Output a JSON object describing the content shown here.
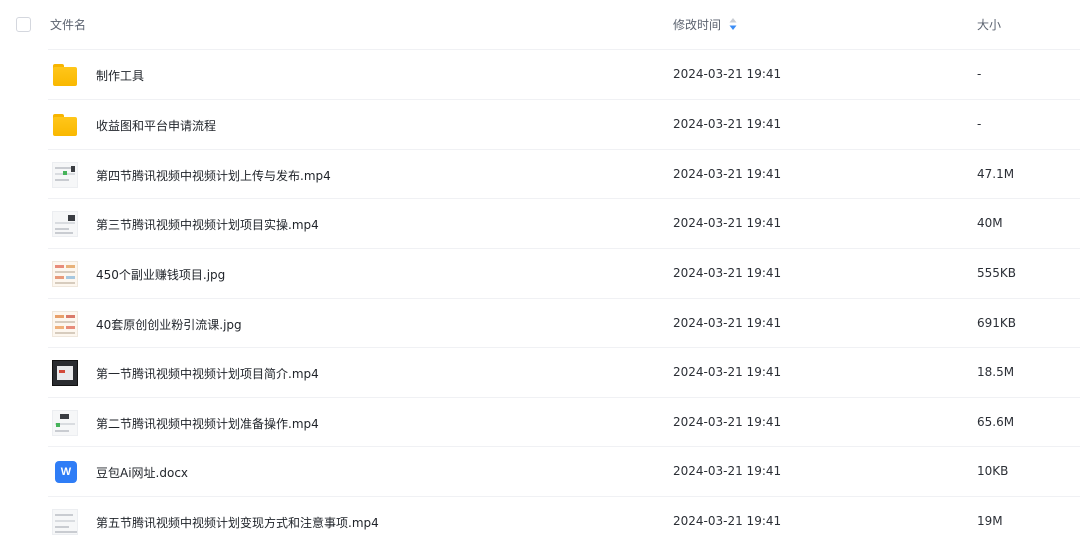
{
  "header": {
    "name_label": "文件名",
    "time_label": "修改时间",
    "size_label": "大小",
    "sort_icon": "sort-arrows-icon"
  },
  "files": [
    {
      "name": "制作工具",
      "time": "2024-03-21 19:41",
      "size": "-",
      "type": "folder"
    },
    {
      "name": "收益图和平台申请流程",
      "time": "2024-03-21 19:41",
      "size": "-",
      "type": "folder"
    },
    {
      "name": "第四节腾讯视频中视频计划上传与发布.mp4",
      "time": "2024-03-21 19:41",
      "size": "47.1M",
      "type": "video"
    },
    {
      "name": "第三节腾讯视频中视频计划项目实操.mp4",
      "time": "2024-03-21 19:41",
      "size": "40M",
      "type": "video"
    },
    {
      "name": "450个副业赚钱项目.jpg",
      "time": "2024-03-21 19:41",
      "size": "555KB",
      "type": "image"
    },
    {
      "name": "40套原创创业粉引流课.jpg",
      "time": "2024-03-21 19:41",
      "size": "691KB",
      "type": "image"
    },
    {
      "name": "第一节腾讯视频中视频计划项目简介.mp4",
      "time": "2024-03-21 19:41",
      "size": "18.5M",
      "type": "video-dark"
    },
    {
      "name": "第二节腾讯视频中视频计划准备操作.mp4",
      "time": "2024-03-21 19:41",
      "size": "65.6M",
      "type": "video"
    },
    {
      "name": "豆包Ai网址.docx",
      "time": "2024-03-21 19:41",
      "size": "10KB",
      "type": "doc",
      "icon_letter": "W"
    },
    {
      "name": "第五节腾讯视频中视频计划变现方式和注意事项.mp4",
      "time": "2024-03-21 19:41",
      "size": "19M",
      "type": "video"
    }
  ],
  "colors": {
    "folder": "#f9b800",
    "word": "#2f7df6",
    "sort_active": "#3b8cf5"
  }
}
